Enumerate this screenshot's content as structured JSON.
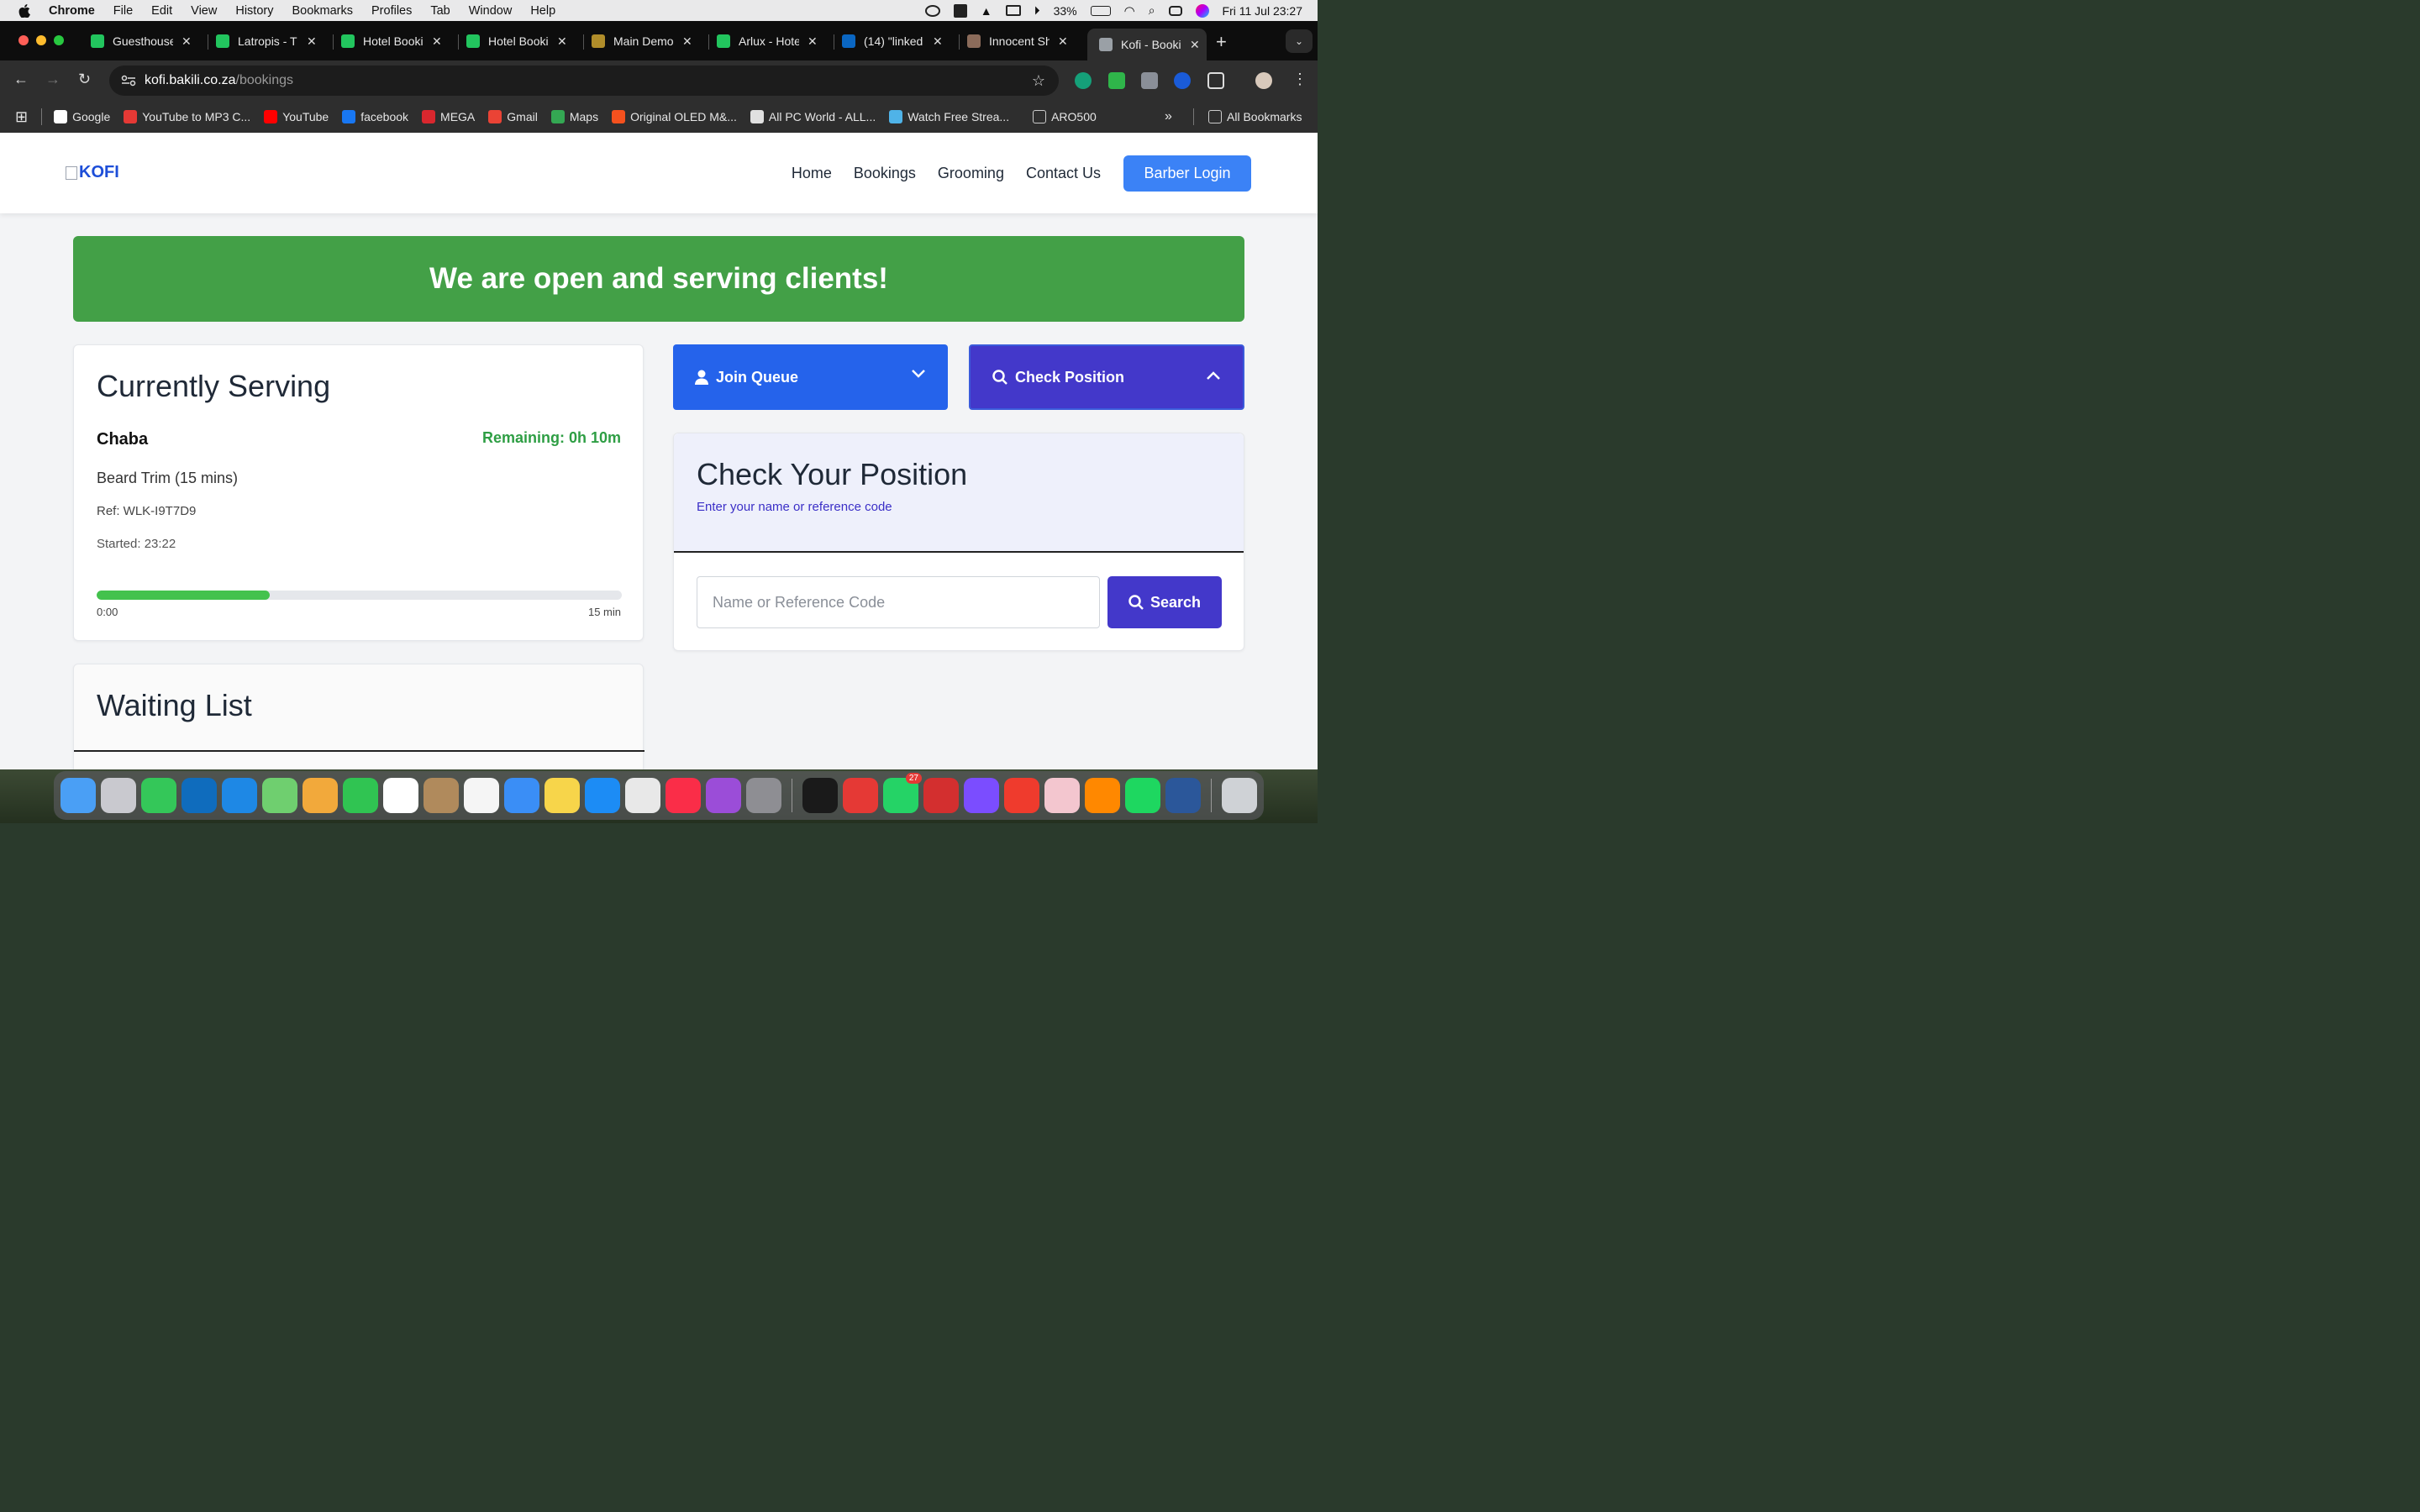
{
  "menubar": {
    "app": "Chrome",
    "items": [
      "File",
      "Edit",
      "View",
      "History",
      "Bookmarks",
      "Profiles",
      "Tab",
      "Window",
      "Help"
    ],
    "battery": "33%",
    "datetime": "Fri 11 Jul  23:27"
  },
  "tabs": [
    {
      "title": "Guesthouse",
      "color": "#22c55e"
    },
    {
      "title": "Latropis - T",
      "color": "#22c55e"
    },
    {
      "title": "Hotel Booki",
      "color": "#22c55e"
    },
    {
      "title": "Hotel Booki",
      "color": "#22c55e"
    },
    {
      "title": "Main Demo",
      "color": "#b08d2a"
    },
    {
      "title": "Arlux - Hote",
      "color": "#22c55e"
    },
    {
      "title": "(14) \"linked",
      "color": "#0a66c2"
    },
    {
      "title": "Innocent Sh",
      "color": "#8b6b5a"
    },
    {
      "title": "Kofi - Booki",
      "color": "#9aa0a6"
    }
  ],
  "address": {
    "host": "kofi.bakili.co.za",
    "path": "/bookings"
  },
  "bookmarks": [
    {
      "label": "Google",
      "color": "#ffffff"
    },
    {
      "label": "YouTube to MP3 C...",
      "color": "#e53935"
    },
    {
      "label": "YouTube",
      "color": "#ff0000"
    },
    {
      "label": "facebook",
      "color": "#1877f2"
    },
    {
      "label": "MEGA",
      "color": "#d9272e"
    },
    {
      "label": "Gmail",
      "color": "#ea4335"
    },
    {
      "label": "Maps",
      "color": "#34a853"
    },
    {
      "label": "Original OLED M&...",
      "color": "#f4511e"
    },
    {
      "label": "All PC World - ALL...",
      "color": "#e0e0e0"
    },
    {
      "label": "Watch Free Strea...",
      "color": "#4fb3e8"
    },
    {
      "label": "ARO500",
      "color": "#cccccc"
    }
  ],
  "all_bookmarks": "All Bookmarks",
  "site": {
    "logo_alt": "KOFI",
    "nav": [
      "Home",
      "Bookings",
      "Grooming",
      "Contact Us"
    ],
    "login": "Barber Login"
  },
  "banner": "We are open and serving clients!",
  "serving": {
    "title": "Currently Serving",
    "client": "Chaba",
    "remaining": "Remaining: 0h 10m",
    "service": "Beard Trim (15 mins)",
    "ref": "Ref: WLK-I9T7D9",
    "started": "Started: 23:22",
    "progress": 0.33,
    "start_label": "0:00",
    "end_label": "15 min"
  },
  "waiting": {
    "title": "Waiting List"
  },
  "queue": {
    "join": "Join Queue",
    "check": "Check Position"
  },
  "check_position": {
    "title": "Check Your Position",
    "subtitle": "Enter your name or reference code",
    "placeholder": "Name or Reference Code",
    "button": "Search"
  },
  "dock": [
    {
      "name": "finder",
      "color": "#4a9ff5"
    },
    {
      "name": "launchpad",
      "color": "#c9c9cf"
    },
    {
      "name": "messages",
      "color": "#34c759"
    },
    {
      "name": "outlook",
      "color": "#0f6cbd"
    },
    {
      "name": "safari",
      "color": "#1e88e5"
    },
    {
      "name": "maps",
      "color": "#6fcf6f"
    },
    {
      "name": "photos",
      "color": "#f2a93b"
    },
    {
      "name": "facetime",
      "color": "#30c452"
    },
    {
      "name": "calendar",
      "color": "#ffffff"
    },
    {
      "name": "contacts",
      "color": "#b08a5c"
    },
    {
      "name": "reminders",
      "color": "#f5f5f5"
    },
    {
      "name": "mail",
      "color": "#3a8ef6"
    },
    {
      "name": "notes",
      "color": "#f7d54a"
    },
    {
      "name": "app-store",
      "color": "#1c8cf5"
    },
    {
      "name": "chrome",
      "color": "#e8e8e8"
    },
    {
      "name": "music",
      "color": "#fa2d48"
    },
    {
      "name": "podcasts",
      "color": "#9b4dd8"
    },
    {
      "name": "system-settings",
      "color": "#8e8e93"
    },
    {
      "name": "terminal",
      "color": "#1a1a1a"
    },
    {
      "name": "anydesk",
      "color": "#e53935"
    },
    {
      "name": "whatsapp",
      "color": "#25d366",
      "badge": "27"
    },
    {
      "name": "acrobat",
      "color": "#d32f2f"
    },
    {
      "name": "canva",
      "color": "#7b4dff"
    },
    {
      "name": "anydesk-alt",
      "color": "#ef3b2d"
    },
    {
      "name": "affinity",
      "color": "#f3c6cf"
    },
    {
      "name": "vlc",
      "color": "#ff8800"
    },
    {
      "name": "spotify",
      "color": "#1ed760"
    },
    {
      "name": "word",
      "color": "#2b579a"
    },
    {
      "name": "trash",
      "color": "#cfd2d6"
    }
  ]
}
